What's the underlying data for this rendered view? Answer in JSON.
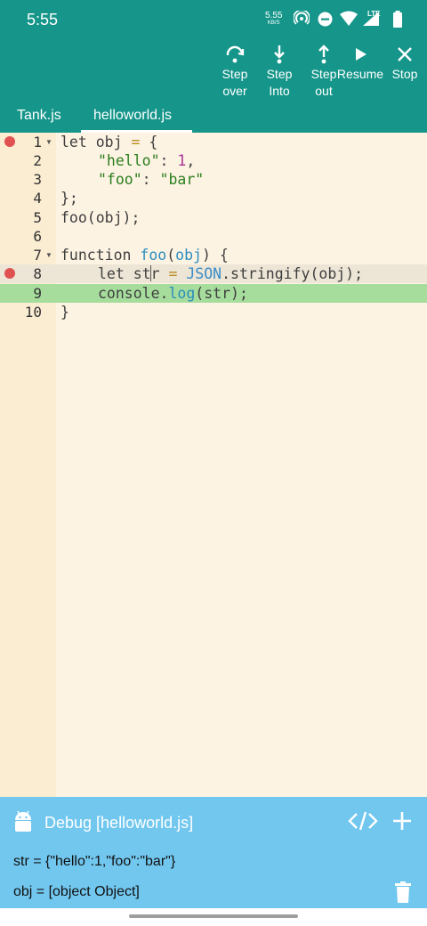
{
  "status_bar": {
    "time": "5:55",
    "net_speed": "5.55",
    "net_unit": "KB/S",
    "network": "LTE"
  },
  "toolbar": {
    "step_over": [
      "Step",
      "over"
    ],
    "step_into": [
      "Step",
      "Into"
    ],
    "step_out": [
      "Step",
      "out"
    ],
    "resume": "Resume",
    "stop": "Stop"
  },
  "tabs": [
    {
      "label": "Tank.js",
      "active": false
    },
    {
      "label": "helloworld.js",
      "active": true
    }
  ],
  "editor": {
    "lines": [
      {
        "no": "1",
        "breakpoint": true,
        "foldable": true
      },
      {
        "no": "2"
      },
      {
        "no": "3"
      },
      {
        "no": "4"
      },
      {
        "no": "5"
      },
      {
        "no": "6"
      },
      {
        "no": "7",
        "foldable": true
      },
      {
        "no": "8",
        "breakpoint": true,
        "current": true
      },
      {
        "no": "9",
        "executing": true
      },
      {
        "no": "10"
      }
    ],
    "code": {
      "l1_kw": "let",
      "l1_var": " obj ",
      "l1_op": "=",
      "l1_rest": " {",
      "l2_str": "\"hello\"",
      "l2_colon": ": ",
      "l2_num": "1",
      "l2_rest": ",",
      "l3_str1": "\"foo\"",
      "l3_colon": ": ",
      "l3_str2": "\"bar\"",
      "l4": "};",
      "l5": "foo(obj);",
      "l6": "",
      "l7_kw": "function ",
      "l7_fn": "foo",
      "l7_p1": "(",
      "l7_arg": "obj",
      "l7_p2": ") {",
      "l8_kw": "let st",
      "l8_after_cursor": "r ",
      "l8_op": "=",
      "l8_sp": " ",
      "l8_json": "JSON",
      "l8_rest": ".stringify(obj);",
      "l9_obj": "console",
      "l9_dot": ".",
      "l9_fn": "log",
      "l9_rest": "(str);",
      "l10": "}"
    }
  },
  "debug": {
    "title": "Debug [helloworld.js]",
    "variables": [
      "str = {\"hello\":1,\"foo\":\"bar\"}",
      "obj = [object Object]"
    ]
  },
  "colors": {
    "primary": "#16968a",
    "debug_panel": "#72c7ef",
    "breakpoint": "#e05252",
    "exec_line": "#a6dc9c"
  }
}
